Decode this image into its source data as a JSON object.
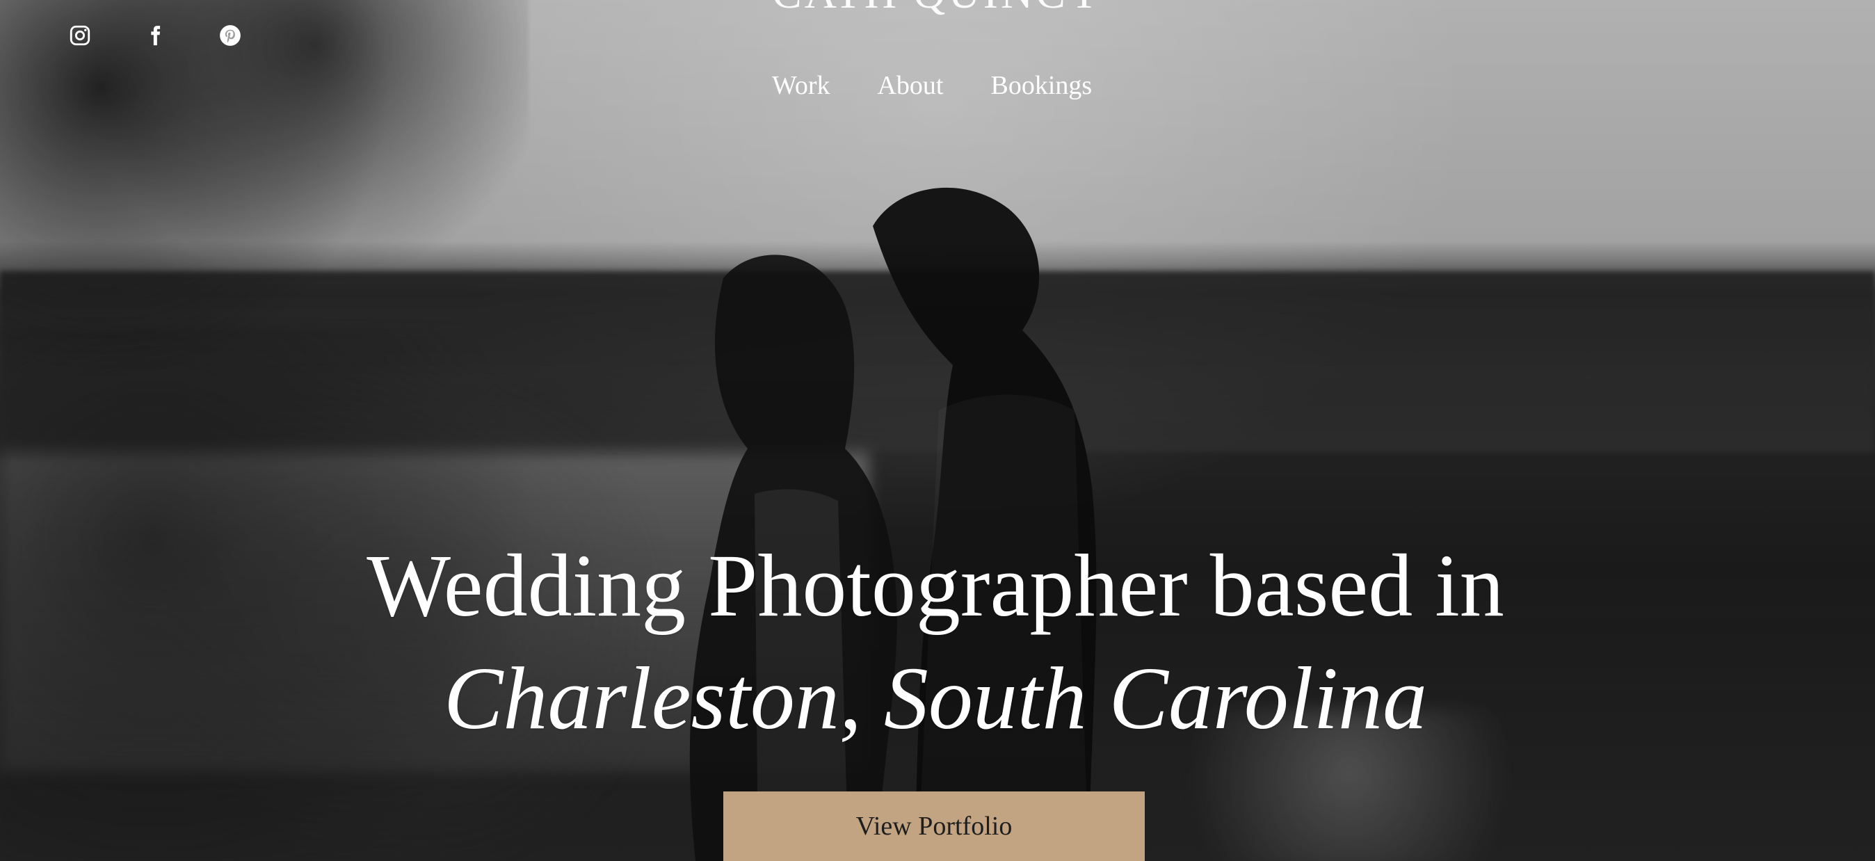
{
  "site": {
    "brand": "CATH QUINCY"
  },
  "social": {
    "items": [
      {
        "name": "instagram",
        "icon": "instagram-icon"
      },
      {
        "name": "facebook",
        "icon": "facebook-icon"
      },
      {
        "name": "pinterest",
        "icon": "pinterest-icon"
      }
    ]
  },
  "nav": {
    "items": [
      {
        "label": "Work"
      },
      {
        "label": "About"
      },
      {
        "label": "Bookings"
      }
    ]
  },
  "hero": {
    "headline_line1": "Wedding Photographer based in",
    "headline_line2": "Charleston, South Carolina",
    "cta_label": "View Portfolio"
  },
  "colors": {
    "accent": "#c2a482",
    "text": "#ffffff",
    "button_text": "#1e1e1e"
  }
}
